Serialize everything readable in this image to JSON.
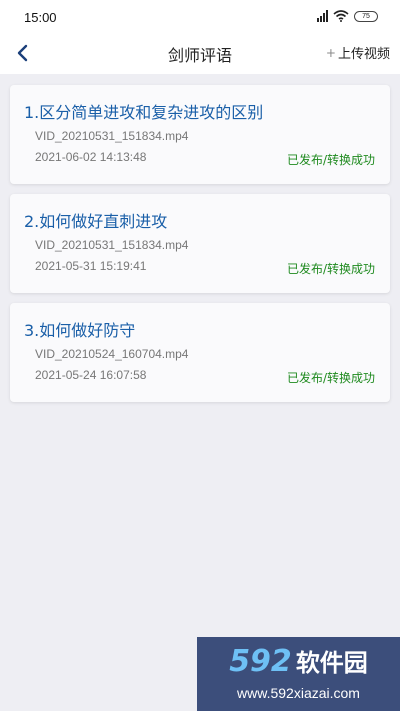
{
  "status_bar": {
    "time": "15:00",
    "battery": "75",
    "icons": [
      "signal-icon",
      "wifi-icon",
      "battery-icon"
    ]
  },
  "header": {
    "title": "剑师评语",
    "upload_label": "上传视频",
    "upload_prefix": "+",
    "back_icon": "chevron-left-icon"
  },
  "items": [
    {
      "title": "1.区分简单进攻和复杂进攻的区别",
      "file": "VID_20210531_151834.mp4",
      "date": "2021-06-02 14:13:48",
      "status": "已发布/转换成功"
    },
    {
      "title": "2.如何做好直刺进攻",
      "file": "VID_20210531_151834.mp4",
      "date": "2021-05-31 15:19:41",
      "status": "已发布/转换成功"
    },
    {
      "title": "3.如何做好防守",
      "file": "VID_20210524_160704.mp4",
      "date": "2021-05-24 16:07:58",
      "status": "已发布/转换成功"
    }
  ],
  "watermark": {
    "number": "592",
    "name": "软件园",
    "url": "www.592xiazai.com"
  },
  "colors": {
    "title_blue": "#1a5fa8",
    "status_green": "#1f8a1f",
    "background": "#eeeef3"
  }
}
